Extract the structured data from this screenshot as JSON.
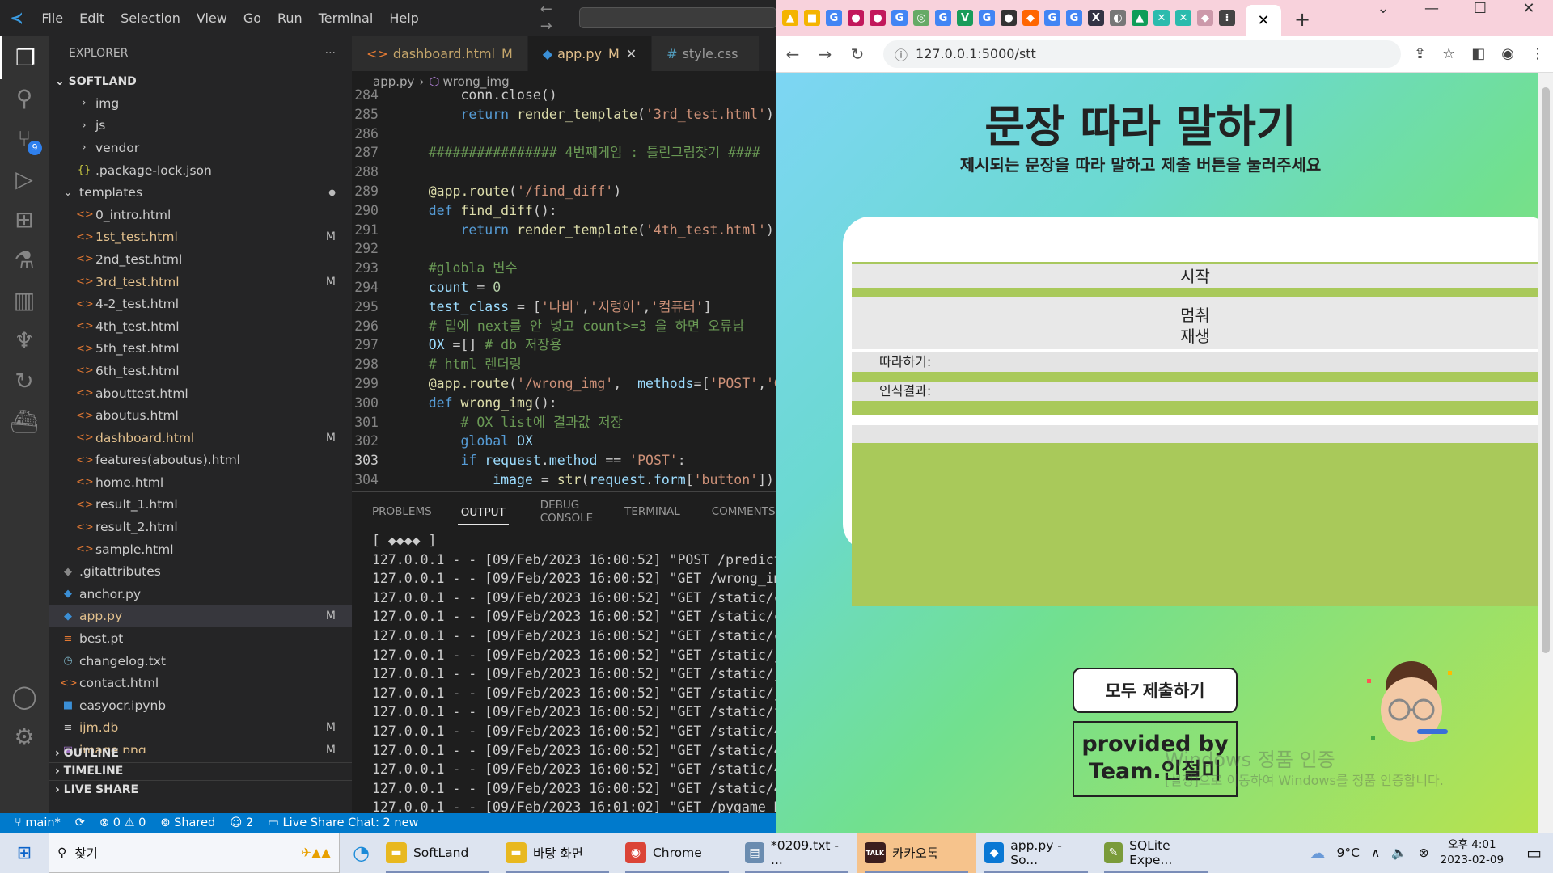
{
  "vscode": {
    "menu": [
      "File",
      "Edit",
      "Selection",
      "View",
      "Go",
      "Run",
      "Terminal",
      "Help"
    ],
    "explorer_title": "EXPLORER",
    "workspace": "SOFTLAND",
    "source_control_badge": "9",
    "tree": [
      {
        "name": "img",
        "indent": 1,
        "icon": "›",
        "type": "folder"
      },
      {
        "name": "js",
        "indent": 1,
        "icon": "›",
        "type": "folder"
      },
      {
        "name": "vendor",
        "indent": 1,
        "icon": "›",
        "type": "folder"
      },
      {
        "name": ".package-lock.json",
        "indent": 1,
        "icon": "{}",
        "type": "json"
      },
      {
        "name": "templates",
        "indent": 0,
        "icon": "⌄",
        "type": "folder",
        "dot": "●"
      },
      {
        "name": "0_intro.html",
        "indent": 1,
        "icon": "<>",
        "type": "html"
      },
      {
        "name": "1st_test.html",
        "indent": 1,
        "icon": "<>",
        "type": "html",
        "mod": "M"
      },
      {
        "name": "2nd_test.html",
        "indent": 1,
        "icon": "<>",
        "type": "html"
      },
      {
        "name": "3rd_test.html",
        "indent": 1,
        "icon": "<>",
        "type": "html",
        "mod": "M"
      },
      {
        "name": "4-2_test.html",
        "indent": 1,
        "icon": "<>",
        "type": "html"
      },
      {
        "name": "4th_test.html",
        "indent": 1,
        "icon": "<>",
        "type": "html"
      },
      {
        "name": "5th_test.html",
        "indent": 1,
        "icon": "<>",
        "type": "html"
      },
      {
        "name": "6th_test.html",
        "indent": 1,
        "icon": "<>",
        "type": "html"
      },
      {
        "name": "abouttest.html",
        "indent": 1,
        "icon": "<>",
        "type": "html"
      },
      {
        "name": "aboutus.html",
        "indent": 1,
        "icon": "<>",
        "type": "html"
      },
      {
        "name": "dashboard.html",
        "indent": 1,
        "icon": "<>",
        "type": "html",
        "mod": "M"
      },
      {
        "name": "features(aboutus).html",
        "indent": 1,
        "icon": "<>",
        "type": "html"
      },
      {
        "name": "home.html",
        "indent": 1,
        "icon": "<>",
        "type": "html"
      },
      {
        "name": "result_1.html",
        "indent": 1,
        "icon": "<>",
        "type": "html"
      },
      {
        "name": "result_2.html",
        "indent": 1,
        "icon": "<>",
        "type": "html"
      },
      {
        "name": "sample.html",
        "indent": 1,
        "icon": "<>",
        "type": "html"
      },
      {
        "name": ".gitattributes",
        "indent": 0,
        "icon": "◆",
        "type": "git"
      },
      {
        "name": "anchor.py",
        "indent": 0,
        "icon": "◆",
        "type": "py"
      },
      {
        "name": "app.py",
        "indent": 0,
        "icon": "◆",
        "type": "py",
        "mod": "M",
        "sel": true
      },
      {
        "name": "best.pt",
        "indent": 0,
        "icon": "≡",
        "type": "pt"
      },
      {
        "name": "changelog.txt",
        "indent": 0,
        "icon": "◷",
        "type": "txt"
      },
      {
        "name": "contact.html",
        "indent": 0,
        "icon": "<>",
        "type": "html"
      },
      {
        "name": "easyocr.ipynb",
        "indent": 0,
        "icon": "■",
        "type": "nb"
      },
      {
        "name": "ijm.db",
        "indent": 0,
        "icon": "≡",
        "type": "db",
        "mod": "M"
      },
      {
        "name": "image.png",
        "indent": 0,
        "icon": "▣",
        "type": "img",
        "mod": "M"
      }
    ],
    "sections": [
      "OUTLINE",
      "TIMELINE",
      "LIVE SHARE"
    ],
    "tabs": [
      {
        "label": "dashboard.html",
        "mod": "M",
        "icon": "<>"
      },
      {
        "label": "app.py",
        "mod": "M",
        "icon": "◆",
        "active": true
      },
      {
        "label": "style.css",
        "mod": "",
        "icon": "#"
      }
    ],
    "breadcrumb": [
      "app.py",
      "wrong_img"
    ],
    "code": [
      {
        "ln": "284",
        "html": "        conn.close()"
      },
      {
        "ln": "285",
        "html": "        <span class='kw'>return</span> <span class='fn'>render_template</span>(<span class='st'>'3rd_test.html'</span>)"
      },
      {
        "ln": "286",
        "html": ""
      },
      {
        "ln": "287",
        "html": "    <span class='cm'>################ 4번째게임 : 틀린그림찾기 ####</span>"
      },
      {
        "ln": "288",
        "html": ""
      },
      {
        "ln": "289",
        "html": "    <span class='dec'>@app.route</span>(<span class='st'>'/find_diff'</span>)"
      },
      {
        "ln": "290",
        "html": "    <span class='kw'>def</span> <span class='fn'>find_diff</span>():"
      },
      {
        "ln": "291",
        "html": "        <span class='kw'>return</span> <span class='fn'>render_template</span>(<span class='st'>'4th_test.html'</span>)"
      },
      {
        "ln": "292",
        "html": ""
      },
      {
        "ln": "293",
        "html": "    <span class='cm'>#globla 변수</span>"
      },
      {
        "ln": "294",
        "html": "    <span class='va'>count</span> = <span class='nm'>0</span>"
      },
      {
        "ln": "295",
        "html": "    <span class='va'>test_class</span> = [<span class='st'>'나비'</span>,<span class='st'>'지렁이'</span>,<span class='st'>'컴퓨터'</span>]"
      },
      {
        "ln": "296",
        "html": "    <span class='cm'># 밑에 next를 안 넣고 count>=3 을 하면 오류남</span>"
      },
      {
        "ln": "297",
        "html": "    <span class='va'>OX</span> =[] <span class='cm'># db 저장용</span>"
      },
      {
        "ln": "298",
        "html": "    <span class='cm'># html 렌더링</span>"
      },
      {
        "ln": "299",
        "html": "    <span class='dec'>@app.route</span>(<span class='st'>'/wrong_img'</span>,  <span class='va'>methods</span>=[<span class='st'>'POST'</span>,<span class='st'>'G</span>"
      },
      {
        "ln": "300",
        "html": "    <span class='kw'>def</span> <span class='fn'>wrong_img</span>():"
      },
      {
        "ln": "301",
        "html": "        <span class='cm'># OX list에 결과값 저장</span>"
      },
      {
        "ln": "302",
        "html": "        <span class='kw'>global</span> <span class='va'>OX</span>"
      },
      {
        "ln": "303",
        "html": "        <span class='kw'>if</span> <span class='va'>request</span>.<span class='va'>method</span> == <span class='st'>'POST'</span>:"
      },
      {
        "ln": "304",
        "html": "            <span class='va'>image</span> = <span class='fn'>str</span>(<span class='va'>request</span>.<span class='va'>form</span>[<span class='st'>'button'</span>])"
      }
    ],
    "panel_tabs": [
      "PROBLEMS",
      "OUTPUT",
      "DEBUG CONSOLE",
      "TERMINAL",
      "COMMENTS"
    ],
    "output": [
      "[ ◆◆◆◆ ]",
      "127.0.0.1 - - [09/Feb/2023 16:00:52] \"POST /predict",
      "127.0.0.1 - - [09/Feb/2023 16:00:52] \"GET /wrong_img",
      "127.0.0.1 - - [09/Feb/2023 16:00:52] \"GET /static/cs",
      "127.0.0.1 - - [09/Feb/2023 16:00:52] \"GET /static/cs",
      "127.0.0.1 - - [09/Feb/2023 16:00:52] \"GET /static/cs",
      "127.0.0.1 - - [09/Feb/2023 16:00:52] \"GET /static/js",
      "127.0.0.1 - - [09/Feb/2023 16:00:52] \"GET /static/js",
      "127.0.0.1 - - [09/Feb/2023 16:00:52] \"GET /static/js",
      "127.0.0.1 - - [09/Feb/2023 16:00:52] \"GET /static/fa",
      "127.0.0.1 - - [09/Feb/2023 16:00:52] \"GET /static/4/",
      "127.0.0.1 - - [09/Feb/2023 16:00:52] \"GET /static/4/",
      "127.0.0.1 - - [09/Feb/2023 16:00:52] \"GET /static/4/",
      "127.0.0.1 - - [09/Feb/2023 16:00:52] \"GET /static/4/",
      "127.0.0.1 - - [09/Feb/2023 16:01:02] \"GET /pygame HT"
    ],
    "status": {
      "branch": "main*",
      "sync": "⟳",
      "problems": "⊗ 0 ⚠ 0",
      "shared": "Shared",
      "people": "2",
      "chat": "Live Share Chat: 2 new"
    }
  },
  "chrome": {
    "url": "127.0.0.1:5000/stt",
    "tab_close": "✕",
    "favicons": [
      {
        "t": "▲",
        "c": "#f4b400"
      },
      {
        "t": "■",
        "c": "#f4b400"
      },
      {
        "t": "G",
        "c": "#4285f4"
      },
      {
        "t": "●",
        "c": "#c2185b"
      },
      {
        "t": "●",
        "c": "#c2185b"
      },
      {
        "t": "G",
        "c": "#4285f4"
      },
      {
        "t": "◎",
        "c": "#6a6"
      },
      {
        "t": "G",
        "c": "#4285f4"
      },
      {
        "t": "V",
        "c": "#1a9c5a"
      },
      {
        "t": "G",
        "c": "#4285f4"
      },
      {
        "t": "●",
        "c": "#333"
      },
      {
        "t": "◆",
        "c": "#f60"
      },
      {
        "t": "G",
        "c": "#4285f4"
      },
      {
        "t": "G",
        "c": "#4285f4"
      },
      {
        "t": "X",
        "c": "#334"
      },
      {
        "t": "◐",
        "c": "#777"
      },
      {
        "t": "▲",
        "c": "#0f9d58"
      },
      {
        "t": "✕",
        "c": "#2bbbad"
      },
      {
        "t": "✕",
        "c": "#2bbbad"
      },
      {
        "t": "◆",
        "c": "#c9a"
      },
      {
        "t": "⁝",
        "c": "#444"
      }
    ],
    "page": {
      "title": "문장 따라 말하기",
      "subtitle": "제시되는 문장을 따라 말하고 제출 버튼을 눌러주세요",
      "start": "시작",
      "stop": "멈춰",
      "play": "재생",
      "follow_label": "따라하기:",
      "result_label": "인식결과:",
      "submit_all": "모두 제출하기",
      "credit_1": "provided by",
      "credit_2": "Team.인절미",
      "watermark_1": "Windows 정품 인증",
      "watermark_2": "[설정]으로 이동하여 Windows를 정품 인증합니다."
    }
  },
  "taskbar": {
    "search": "찾기",
    "items": [
      {
        "label": "SoftLand",
        "icon": "▬",
        "c": "#e8b820"
      },
      {
        "label": "바탕 화면",
        "icon": "▬",
        "c": "#e8b820"
      },
      {
        "label": "Chrome",
        "icon": "◉",
        "c": "#db4437"
      },
      {
        "label": "*0209.txt - ...",
        "icon": "▤",
        "c": "#6a8cb0"
      },
      {
        "label": "카카오톡",
        "icon": "TALK",
        "c": "#3c1e1e"
      },
      {
        "label": "app.py - So...",
        "icon": "◆",
        "c": "#0a78d4"
      },
      {
        "label": "SQLite Expe...",
        "icon": "✎",
        "c": "#7a9b3a"
      }
    ],
    "weather": "9°C",
    "time": "오후 4:01",
    "date": "2023-02-09"
  }
}
